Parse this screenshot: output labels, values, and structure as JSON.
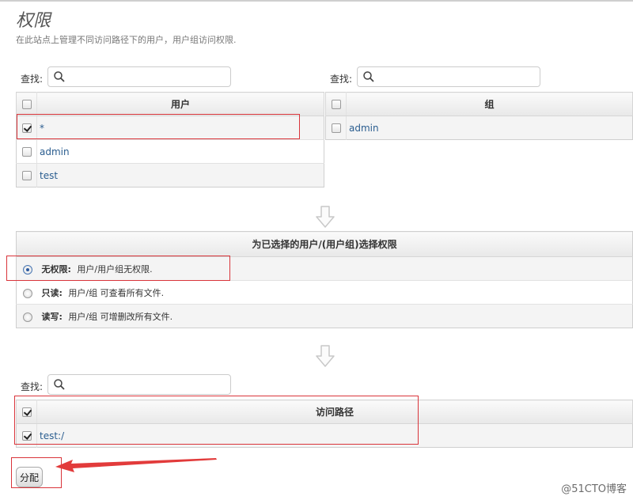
{
  "page": {
    "title": "权限",
    "subtitle": "在此站点上管理不同访问路径下的用户，用户组访问权限."
  },
  "search_label": "查找:",
  "users_table": {
    "header": "用户",
    "rows": [
      {
        "name": "*",
        "checked": true
      },
      {
        "name": "admin",
        "checked": false
      },
      {
        "name": "test",
        "checked": false
      }
    ]
  },
  "groups_table": {
    "header": "组",
    "rows": [
      {
        "name": "admin",
        "checked": false
      }
    ]
  },
  "permissions": {
    "header": "为已选择的用户/(用户组)选择权限",
    "options": [
      {
        "label": "无权限:",
        "desc": "用户/用户组无权限.",
        "selected": true
      },
      {
        "label": "只读:",
        "desc": "用户/组 可查看所有文件.",
        "selected": false
      },
      {
        "label": "读写:",
        "desc": "用户/组 可增删改所有文件.",
        "selected": false
      }
    ]
  },
  "paths_table": {
    "header": "访问路径",
    "rows": [
      {
        "name": "test:/",
        "checked": true
      }
    ]
  },
  "assign_button": "分配",
  "watermark": "@51CTO博客",
  "colors": {
    "highlight_red": "#d9343a",
    "link_blue": "#2a5d8f"
  }
}
